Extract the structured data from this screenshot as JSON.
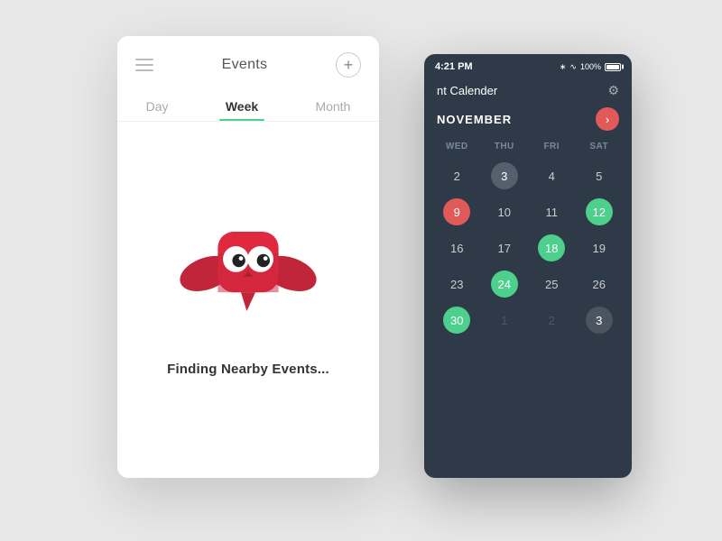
{
  "events_card": {
    "title": "Events",
    "add_label": "+",
    "tabs": [
      {
        "label": "Day",
        "active": false
      },
      {
        "label": "Week",
        "active": true
      },
      {
        "label": "Month",
        "active": false
      }
    ],
    "finding_text": "Finding Nearby Events..."
  },
  "calendar_card": {
    "status_time": "4:21 PM",
    "status_battery": "100%",
    "title": "nt Calender",
    "month": "NOVEMBER",
    "day_labels": [
      "WED",
      "THU",
      "FRI",
      "SAT"
    ],
    "weeks": [
      [
        {
          "num": "2",
          "style": "normal"
        },
        {
          "num": "3",
          "style": "today"
        },
        {
          "num": "4",
          "style": "normal"
        },
        {
          "num": "5",
          "style": "normal"
        }
      ],
      [
        {
          "num": "9",
          "style": "red"
        },
        {
          "num": "10",
          "style": "normal"
        },
        {
          "num": "11",
          "style": "normal"
        },
        {
          "num": "12",
          "style": "green"
        }
      ],
      [
        {
          "num": "16",
          "style": "normal"
        },
        {
          "num": "17",
          "style": "normal"
        },
        {
          "num": "18",
          "style": "green"
        },
        {
          "num": "19",
          "style": "normal"
        }
      ],
      [
        {
          "num": "23",
          "style": "normal"
        },
        {
          "num": "24",
          "style": "green"
        },
        {
          "num": "25",
          "style": "normal"
        },
        {
          "num": "26",
          "style": "normal"
        }
      ],
      [
        {
          "num": "30",
          "style": "green"
        },
        {
          "num": "1",
          "style": "muted"
        },
        {
          "num": "2",
          "style": "muted"
        },
        {
          "num": "3",
          "style": "gray-circle"
        }
      ]
    ]
  }
}
